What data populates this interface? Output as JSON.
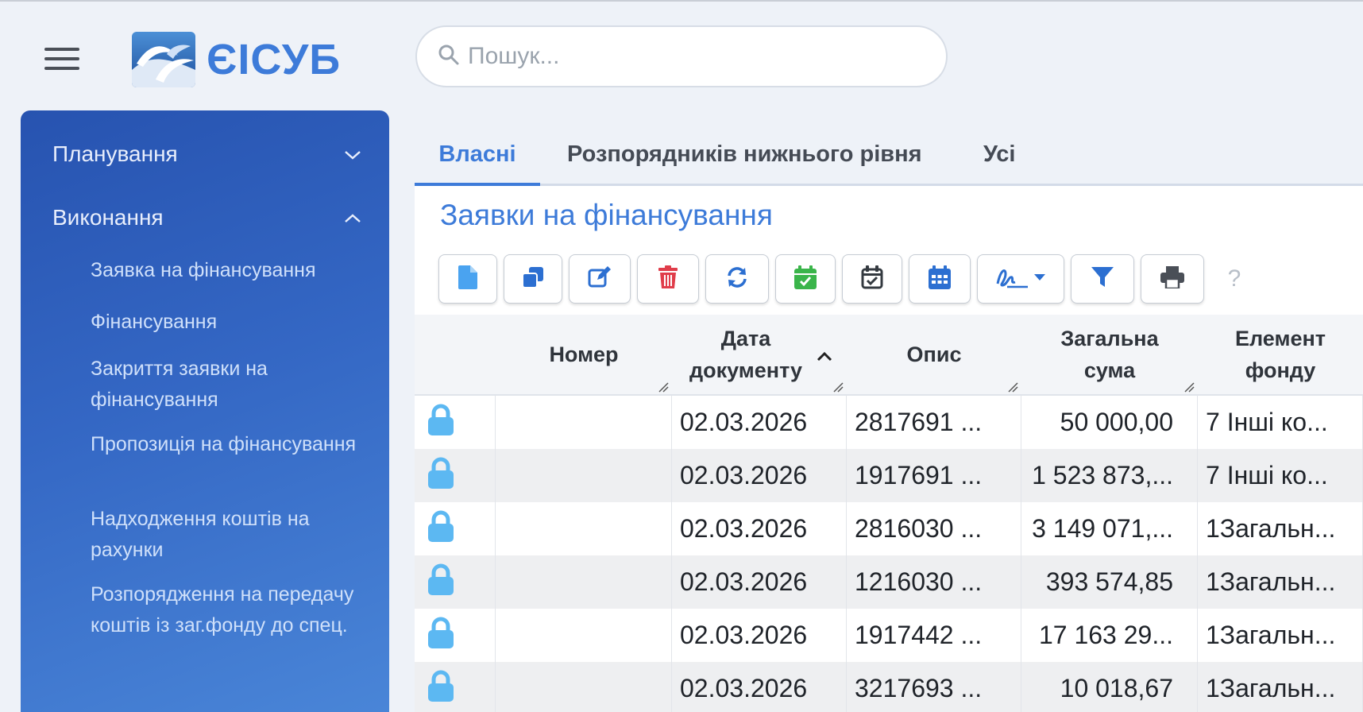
{
  "app": {
    "logo_text": "ЄІСУБ"
  },
  "search": {
    "placeholder": "Пошук..."
  },
  "sidebar": {
    "sections": [
      {
        "label": "Планування",
        "expanded": false
      },
      {
        "label": "Виконання",
        "expanded": true
      }
    ],
    "items": [
      "Заявка на фінансування",
      "Фінансування",
      "Закриття заявки на фінансування",
      "Пропозиція на фінансування",
      "Надходження коштів на рахунки",
      "Розпорядження на передачу коштів із заг.фонду до спец."
    ]
  },
  "tabs": [
    {
      "label": "Власні",
      "active": true
    },
    {
      "label": "Розпорядників нижнього рівня",
      "active": false
    },
    {
      "label": "Усі",
      "active": false
    }
  ],
  "page": {
    "title": "Заявки на фінансування"
  },
  "toolbar": {
    "buttons": [
      {
        "icon": "new-document-icon",
        "color": "#4aa3f0"
      },
      {
        "icon": "copy-icon",
        "color": "#2c6fd1"
      },
      {
        "icon": "edit-icon",
        "color": "#2c6fd1"
      },
      {
        "icon": "trash-icon",
        "color": "#e03d4a"
      },
      {
        "icon": "refresh-icon",
        "color": "#2c6fd1"
      },
      {
        "icon": "calendar-check-icon",
        "color": "#3ab54a"
      },
      {
        "icon": "calendar-check-outline-icon",
        "color": "#343a40"
      },
      {
        "icon": "calendar-grid-icon",
        "color": "#2c6fd1"
      },
      {
        "icon": "signature-icon",
        "color": "#2c6fd1"
      },
      {
        "icon": "filter-icon",
        "color": "#2c6fd1"
      },
      {
        "icon": "print-icon",
        "color": "#4a4f57"
      },
      {
        "icon": "help-icon",
        "label": "?"
      }
    ]
  },
  "table": {
    "headers": [
      {
        "label": ""
      },
      {
        "label": "Номер"
      },
      {
        "label": "Дата документу",
        "sorted": "asc"
      },
      {
        "label": "Опис"
      },
      {
        "label": "Загальна сума"
      },
      {
        "label": "Елемент фонду"
      }
    ],
    "rows": [
      {
        "locked": true,
        "number": "",
        "date": "02.03.2026",
        "description": "2817691 ...",
        "amount": "50 000,00",
        "fund": "7 Інші ко..."
      },
      {
        "locked": true,
        "number": "",
        "date": "02.03.2026",
        "description": "1917691 ...",
        "amount": "1 523 873,...",
        "fund": "7 Інші ко..."
      },
      {
        "locked": true,
        "number": "",
        "date": "02.03.2026",
        "description": "2816030 ...",
        "amount": "3 149 071,...",
        "fund": "1Загальн..."
      },
      {
        "locked": true,
        "number": "",
        "date": "02.03.2026",
        "description": "1216030 ...",
        "amount": "393 574,85",
        "fund": "1Загальн..."
      },
      {
        "locked": true,
        "number": "",
        "date": "02.03.2026",
        "description": "1917442 ...",
        "amount": "17 163 29...",
        "fund": "1Загальн..."
      },
      {
        "locked": true,
        "number": "",
        "date": "02.03.2026",
        "description": "3217693 ...",
        "amount": "10 018,67",
        "fund": "1Загальн..."
      }
    ]
  },
  "colors": {
    "accent": "#3d7bd9",
    "lock": "#5cb8f2",
    "sidebar_top": "#2753b0",
    "sidebar_bottom": "#4a86d8"
  }
}
